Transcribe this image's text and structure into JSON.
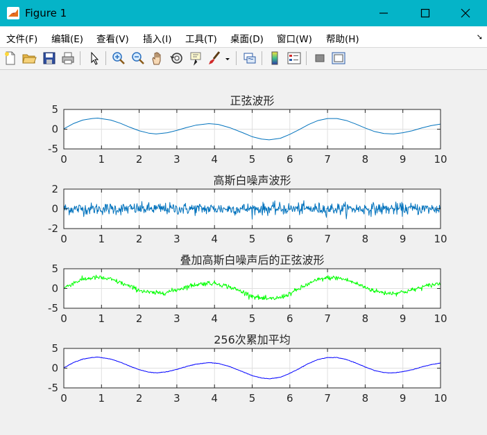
{
  "window": {
    "title": "Figure 1",
    "icon": "matlab-figure-icon"
  },
  "menu": {
    "items": [
      "文件(F)",
      "编辑(E)",
      "查看(V)",
      "插入(I)",
      "工具(T)",
      "桌面(D)",
      "窗口(W)",
      "帮助(H)"
    ],
    "dock_icon": "dock-arrow-icon",
    "dock_glyph": "➘"
  },
  "toolbar": {
    "icons": [
      "new-figure-icon",
      "open-file-icon",
      "save-icon",
      "print-icon",
      "edit-plot-arrow-icon",
      "zoom-in-icon",
      "zoom-out-icon",
      "pan-hand-icon",
      "rotate-3d-icon",
      "data-cursor-icon",
      "brush-icon",
      "brush-dropdown-icon",
      "link-plot-icon",
      "colorbar-icon",
      "legend-icon",
      "hide-plot-tools-icon",
      "show-plot-tools-icon"
    ]
  },
  "colors": {
    "titlebar": "#05b4c8",
    "matlab_blue": "#0072bd",
    "green": "#00ff00",
    "blue": "#0000ff",
    "axes_bg": "#ffffff",
    "axes_edge": "#262626",
    "grid": "#dfdfdf"
  },
  "chart_data": [
    {
      "type": "line",
      "title": "正弦波形",
      "xlim": [
        0,
        10
      ],
      "ylim": [
        -5,
        5
      ],
      "xticks": [
        "0",
        "1",
        "2",
        "3",
        "4",
        "5",
        "6",
        "7",
        "8",
        "9",
        "10"
      ],
      "yticks": [
        "5",
        "0",
        "-5"
      ],
      "grid": true,
      "series": [
        {
          "color": "#0072bd",
          "noise": 0,
          "x": [
            0,
            0.25,
            0.5,
            0.75,
            0.9,
            1.25,
            1.5,
            1.75,
            2.0,
            2.25,
            2.45,
            2.75,
            3.0,
            3.25,
            3.5,
            3.85,
            4.1,
            4.4,
            4.75,
            5.0,
            5.25,
            5.45,
            5.75,
            6.0,
            6.25,
            6.5,
            6.75,
            7.0,
            7.25,
            7.5,
            7.75,
            8.0,
            8.25,
            8.5,
            8.75,
            9.0,
            9.25,
            9.5,
            9.75,
            10.0
          ],
          "y": [
            0.1,
            1.4,
            2.3,
            2.7,
            2.8,
            2.3,
            1.5,
            0.5,
            -0.4,
            -1.0,
            -1.2,
            -0.9,
            -0.3,
            0.4,
            1.0,
            1.4,
            1.2,
            0.4,
            -0.9,
            -1.9,
            -2.5,
            -2.7,
            -2.3,
            -1.3,
            -0.1,
            1.2,
            2.2,
            2.7,
            2.7,
            2.2,
            1.3,
            0.3,
            -0.6,
            -1.1,
            -1.2,
            -0.9,
            -0.4,
            0.3,
            0.9,
            1.3
          ]
        }
      ]
    },
    {
      "type": "line",
      "title": "高斯白噪声波形",
      "xlim": [
        0,
        10
      ],
      "ylim": [
        -2,
        2
      ],
      "xticks": [
        "0",
        "1",
        "2",
        "3",
        "4",
        "5",
        "6",
        "7",
        "8",
        "9",
        "10"
      ],
      "yticks": [
        "2",
        "0",
        "-2"
      ],
      "grid": true,
      "series": [
        {
          "color": "#0072bd",
          "noise": 0.3,
          "x": [
            0,
            10
          ],
          "y": [
            0,
            0
          ]
        }
      ]
    },
    {
      "type": "line",
      "title": "叠加高斯白噪声后的正弦波形",
      "xlim": [
        0,
        10
      ],
      "ylim": [
        -5,
        5
      ],
      "xticks": [
        "0",
        "1",
        "2",
        "3",
        "4",
        "5",
        "6",
        "7",
        "8",
        "9",
        "10"
      ],
      "yticks": [
        "5",
        "0",
        "-5"
      ],
      "grid": true,
      "series": [
        {
          "color": "#00ff00",
          "noise": 0.3,
          "x": [
            0,
            0.25,
            0.5,
            0.75,
            0.9,
            1.25,
            1.5,
            1.75,
            2.0,
            2.25,
            2.45,
            2.75,
            3.0,
            3.25,
            3.5,
            3.85,
            4.1,
            4.4,
            4.75,
            5.0,
            5.25,
            5.45,
            5.75,
            6.0,
            6.25,
            6.5,
            6.75,
            7.0,
            7.25,
            7.5,
            7.75,
            8.0,
            8.25,
            8.5,
            8.75,
            9.0,
            9.25,
            9.5,
            9.75,
            10.0
          ],
          "y": [
            0.1,
            1.4,
            2.3,
            2.7,
            2.8,
            2.3,
            1.5,
            0.5,
            -0.4,
            -1.0,
            -1.2,
            -0.9,
            -0.3,
            0.4,
            1.0,
            1.4,
            1.2,
            0.4,
            -0.9,
            -1.9,
            -2.5,
            -2.7,
            -2.3,
            -1.3,
            -0.1,
            1.2,
            2.2,
            2.7,
            2.7,
            2.2,
            1.3,
            0.3,
            -0.6,
            -1.1,
            -1.2,
            -0.9,
            -0.4,
            0.3,
            0.9,
            1.3
          ]
        }
      ]
    },
    {
      "type": "line",
      "title": "256次累加平均",
      "xlim": [
        0,
        10
      ],
      "ylim": [
        -5,
        5
      ],
      "xticks": [
        "0",
        "1",
        "2",
        "3",
        "4",
        "5",
        "6",
        "7",
        "8",
        "9",
        "10"
      ],
      "yticks": [
        "5",
        "0",
        "-5"
      ],
      "grid": true,
      "series": [
        {
          "color": "#0000ff",
          "noise": 0.03,
          "x": [
            0,
            0.25,
            0.5,
            0.75,
            0.9,
            1.25,
            1.5,
            1.75,
            2.0,
            2.25,
            2.45,
            2.75,
            3.0,
            3.25,
            3.5,
            3.85,
            4.1,
            4.4,
            4.75,
            5.0,
            5.25,
            5.45,
            5.75,
            6.0,
            6.25,
            6.5,
            6.75,
            7.0,
            7.25,
            7.5,
            7.75,
            8.0,
            8.25,
            8.5,
            8.75,
            9.0,
            9.25,
            9.5,
            9.75,
            10.0
          ],
          "y": [
            0.1,
            1.4,
            2.3,
            2.7,
            2.8,
            2.3,
            1.5,
            0.5,
            -0.4,
            -1.0,
            -1.2,
            -0.9,
            -0.3,
            0.4,
            1.0,
            1.4,
            1.2,
            0.4,
            -0.9,
            -1.9,
            -2.5,
            -2.7,
            -2.3,
            -1.3,
            -0.1,
            1.2,
            2.2,
            2.7,
            2.7,
            2.2,
            1.3,
            0.3,
            -0.6,
            -1.1,
            -1.2,
            -0.9,
            -0.4,
            0.3,
            0.9,
            1.3
          ]
        }
      ]
    }
  ]
}
